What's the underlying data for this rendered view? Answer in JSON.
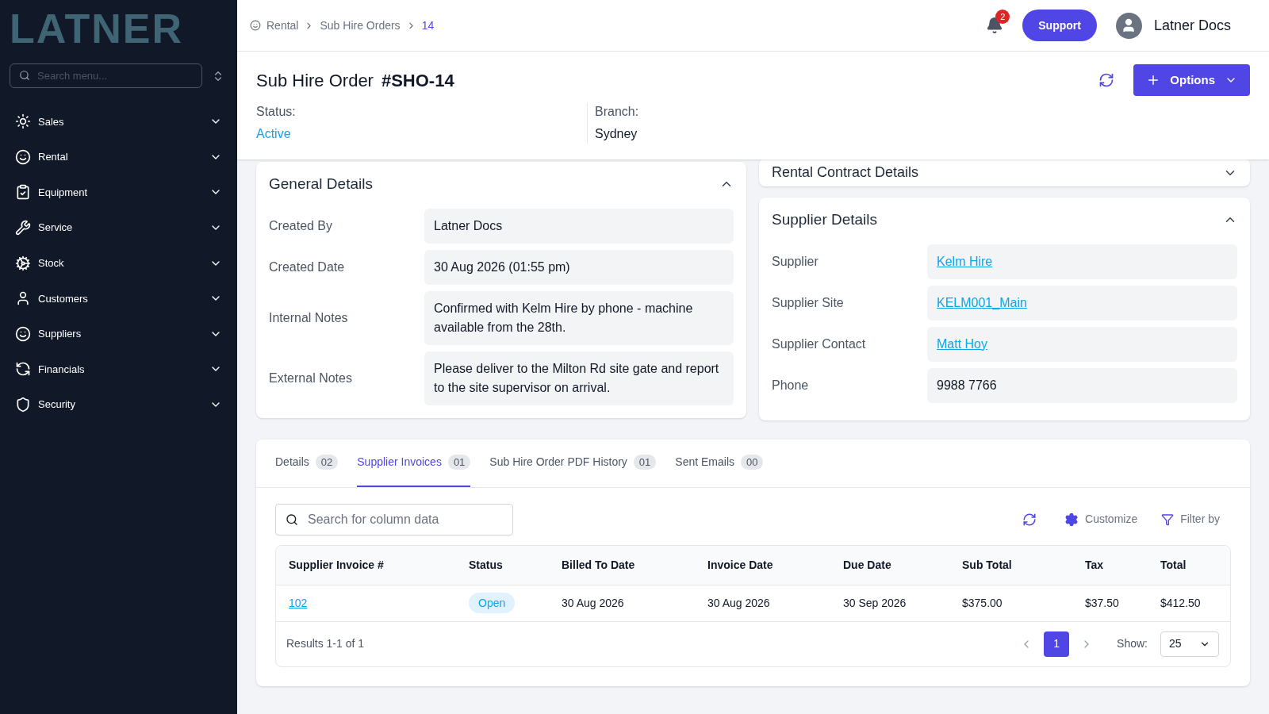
{
  "sidebar": {
    "logo": "LATNER",
    "search": {
      "placeholder": "Search menu..."
    },
    "items": [
      {
        "label": "Sales",
        "expanded": false
      },
      {
        "label": "Rental",
        "expanded": false
      },
      {
        "label": "Equipment",
        "expanded": false
      },
      {
        "label": "Service",
        "expanded": false
      },
      {
        "label": "Stock",
        "expanded": false
      },
      {
        "label": "Customers",
        "expanded": false
      },
      {
        "label": "Suppliers",
        "expanded": false
      },
      {
        "label": "Financials",
        "expanded": false
      },
      {
        "label": "Security",
        "expanded": false
      }
    ]
  },
  "topbar": {
    "breadcrumbs": [
      {
        "label": "Rental",
        "selected": false
      },
      {
        "label": "Sub Hire Orders",
        "selected": false
      },
      {
        "label": "14",
        "selected": true
      }
    ],
    "notifications": "2",
    "support": "Support",
    "user": "Latner Docs"
  },
  "header": {
    "title": "Sub Hire Order",
    "number": "#SHO-14",
    "options": "Options",
    "fields": [
      {
        "label": "Status:",
        "value": "Active",
        "kind": "status"
      },
      {
        "label": "Branch:",
        "value": "Sydney",
        "kind": "text"
      }
    ]
  },
  "general_details": {
    "title": "General Details",
    "expanded": true,
    "rows": [
      {
        "label": "Created By",
        "value": "Latner Docs"
      },
      {
        "label": "Created Date",
        "value": "30 Aug 2026 (01:55 pm)"
      },
      {
        "label": "Internal Notes",
        "value": "Confirmed with Kelm Hire by phone - machine available from the 28th."
      },
      {
        "label": "External Notes",
        "value": "Please deliver to the Milton Rd site gate and report to the site supervisor on arrival."
      }
    ]
  },
  "rental_contract_details": {
    "title": "Rental Contract Details",
    "expanded": false
  },
  "supplier_details": {
    "title": "Supplier Details",
    "expanded": true,
    "rows": [
      {
        "label": "Supplier",
        "value": "Kelm Hire",
        "kind": "link"
      },
      {
        "label": "Supplier Site",
        "value": "KELM001_Main",
        "kind": "link"
      },
      {
        "label": "Supplier Contact",
        "value": "Matt Hoy",
        "kind": "link"
      },
      {
        "label": "Phone",
        "value": "9988 7766",
        "kind": "text"
      }
    ]
  },
  "tabs": [
    {
      "label": "Details",
      "count": "02",
      "selected": false
    },
    {
      "label": "Supplier Invoices",
      "count": "01",
      "selected": true
    },
    {
      "label": "Sub Hire Order PDF History",
      "count": "01",
      "selected": false
    },
    {
      "label": "Sent Emails",
      "count": "00",
      "selected": false
    }
  ],
  "table_toolbar": {
    "search": {
      "placeholder": "Search for column data"
    },
    "customize": "Customize",
    "filter": "Filter by"
  },
  "table": {
    "columns": [
      "Supplier Invoice #",
      "Status",
      "Billed To Date",
      "Invoice Date",
      "Due Date",
      "Sub Total",
      "Tax",
      "Total"
    ],
    "rows": [
      {
        "invoice": "102",
        "status": "Open",
        "billed_to_date": "30 Aug 2026",
        "invoice_date": "30 Aug 2026",
        "due_date": "30 Sep 2026",
        "sub_total": "$375.00",
        "tax": "$37.50",
        "total": "$412.50"
      }
    ]
  },
  "pagination": {
    "results": "Results 1-1 of 1",
    "pages": [
      {
        "label": "1",
        "selected": true
      }
    ],
    "show_label": "Show:",
    "page_size": "25"
  }
}
